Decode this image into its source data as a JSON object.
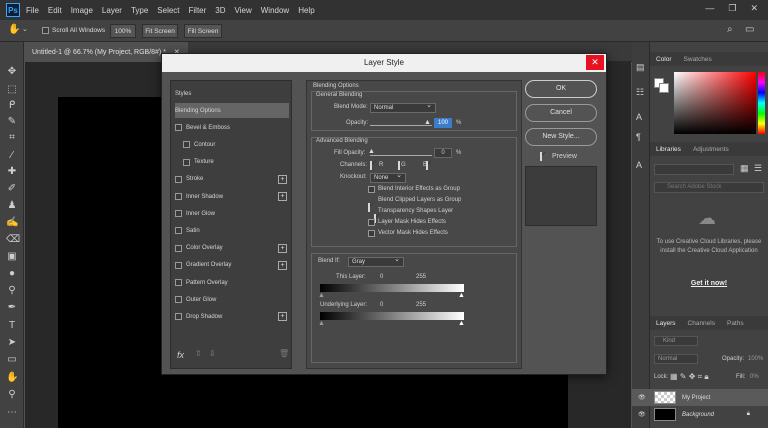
{
  "menubar": {
    "logo": "Ps",
    "items": [
      "File",
      "Edit",
      "Image",
      "Layer",
      "Type",
      "Select",
      "Filter",
      "3D",
      "View",
      "Window",
      "Help"
    ]
  },
  "optionsbar": {
    "scroll_all": "Scroll All Windows",
    "zoom_100": "100%",
    "fit_screen": "Fit Screen",
    "fill_screen": "Fill Screen"
  },
  "document": {
    "tab_title": "Untitled-1 @ 66.7% (My Project, RGB/8#) *"
  },
  "dialog": {
    "title": "Layer Style",
    "styles_header": "Styles",
    "styles": [
      {
        "label": "Blending Options",
        "checkbox": false,
        "checked": false,
        "plus": false,
        "selected": true
      },
      {
        "label": "Bevel & Emboss",
        "checkbox": true,
        "checked": false,
        "plus": false,
        "selected": false
      },
      {
        "label": "Contour",
        "checkbox": true,
        "checked": false,
        "plus": false,
        "selected": false
      },
      {
        "label": "Texture",
        "checkbox": true,
        "checked": false,
        "plus": false,
        "selected": false
      },
      {
        "label": "Stroke",
        "checkbox": true,
        "checked": false,
        "plus": true,
        "selected": false
      },
      {
        "label": "Inner Shadow",
        "checkbox": true,
        "checked": false,
        "plus": true,
        "selected": false
      },
      {
        "label": "Inner Glow",
        "checkbox": true,
        "checked": false,
        "plus": false,
        "selected": false
      },
      {
        "label": "Satin",
        "checkbox": true,
        "checked": false,
        "plus": false,
        "selected": false
      },
      {
        "label": "Color Overlay",
        "checkbox": true,
        "checked": false,
        "plus": true,
        "selected": false
      },
      {
        "label": "Gradient Overlay",
        "checkbox": true,
        "checked": false,
        "plus": true,
        "selected": false
      },
      {
        "label": "Pattern Overlay",
        "checkbox": true,
        "checked": false,
        "plus": false,
        "selected": false
      },
      {
        "label": "Outer Glow",
        "checkbox": true,
        "checked": false,
        "plus": false,
        "selected": false
      },
      {
        "label": "Drop Shadow",
        "checkbox": true,
        "checked": false,
        "plus": true,
        "selected": false
      }
    ],
    "fx_label": "fx",
    "blending": {
      "section_title": "Blending Options",
      "general_title": "General Blending",
      "blend_mode_label": "Blend Mode:",
      "blend_mode_value": "Normal",
      "opacity_label": "Opacity:",
      "opacity_value": "100",
      "percent": "%",
      "advanced_title": "Advanced Blending",
      "fill_opacity_label": "Fill Opacity:",
      "fill_opacity_value": "0",
      "channels_label": "Channels:",
      "channel_r": "R",
      "channel_g": "G",
      "channel_b": "B",
      "knockout_label": "Knockout:",
      "knockout_value": "None",
      "options": [
        {
          "label": "Blend Interior Effects as Group",
          "checked": false
        },
        {
          "label": "Blend Clipped Layers as Group",
          "checked": true
        },
        {
          "label": "Transparency Shapes Layer",
          "checked": true
        },
        {
          "label": "Layer Mask Hides Effects",
          "checked": false
        },
        {
          "label": "Vector Mask Hides Effects",
          "checked": false
        }
      ],
      "blend_if_label": "Blend If:",
      "blend_if_value": "Gray",
      "this_layer_label": "This Layer:",
      "underlying_label": "Underlying Layer:",
      "min": "0",
      "max": "255"
    },
    "buttons": {
      "ok": "OK",
      "cancel": "Cancel",
      "new_style": "New Style...",
      "preview": "Preview"
    }
  },
  "right_panel": {
    "color_tab": "Color",
    "swatches_tab": "Swatches",
    "libraries_tab": "Libraries",
    "adjustments_tab": "Adjustments",
    "search_placeholder": "Search Adobe Stock",
    "lib_message": "To use Creative Cloud Libraries, please install the Creative Cloud Application",
    "get_it_now": "Get it now!",
    "layers_tab": "Layers",
    "channels_tab": "Channels",
    "paths_tab": "Paths",
    "kind_label": "Kind",
    "blend_mode": "Normal",
    "opacity_label": "Opacity:",
    "opacity_value": "100%",
    "lock_label": "Lock:",
    "fill_label": "Fill:",
    "fill_value": "0%",
    "layers": [
      {
        "name": "My Project",
        "selected": true
      },
      {
        "name": "Background",
        "selected": false
      }
    ]
  },
  "colors": {
    "accent": "#31a8ff",
    "close_red": "#e81123"
  }
}
